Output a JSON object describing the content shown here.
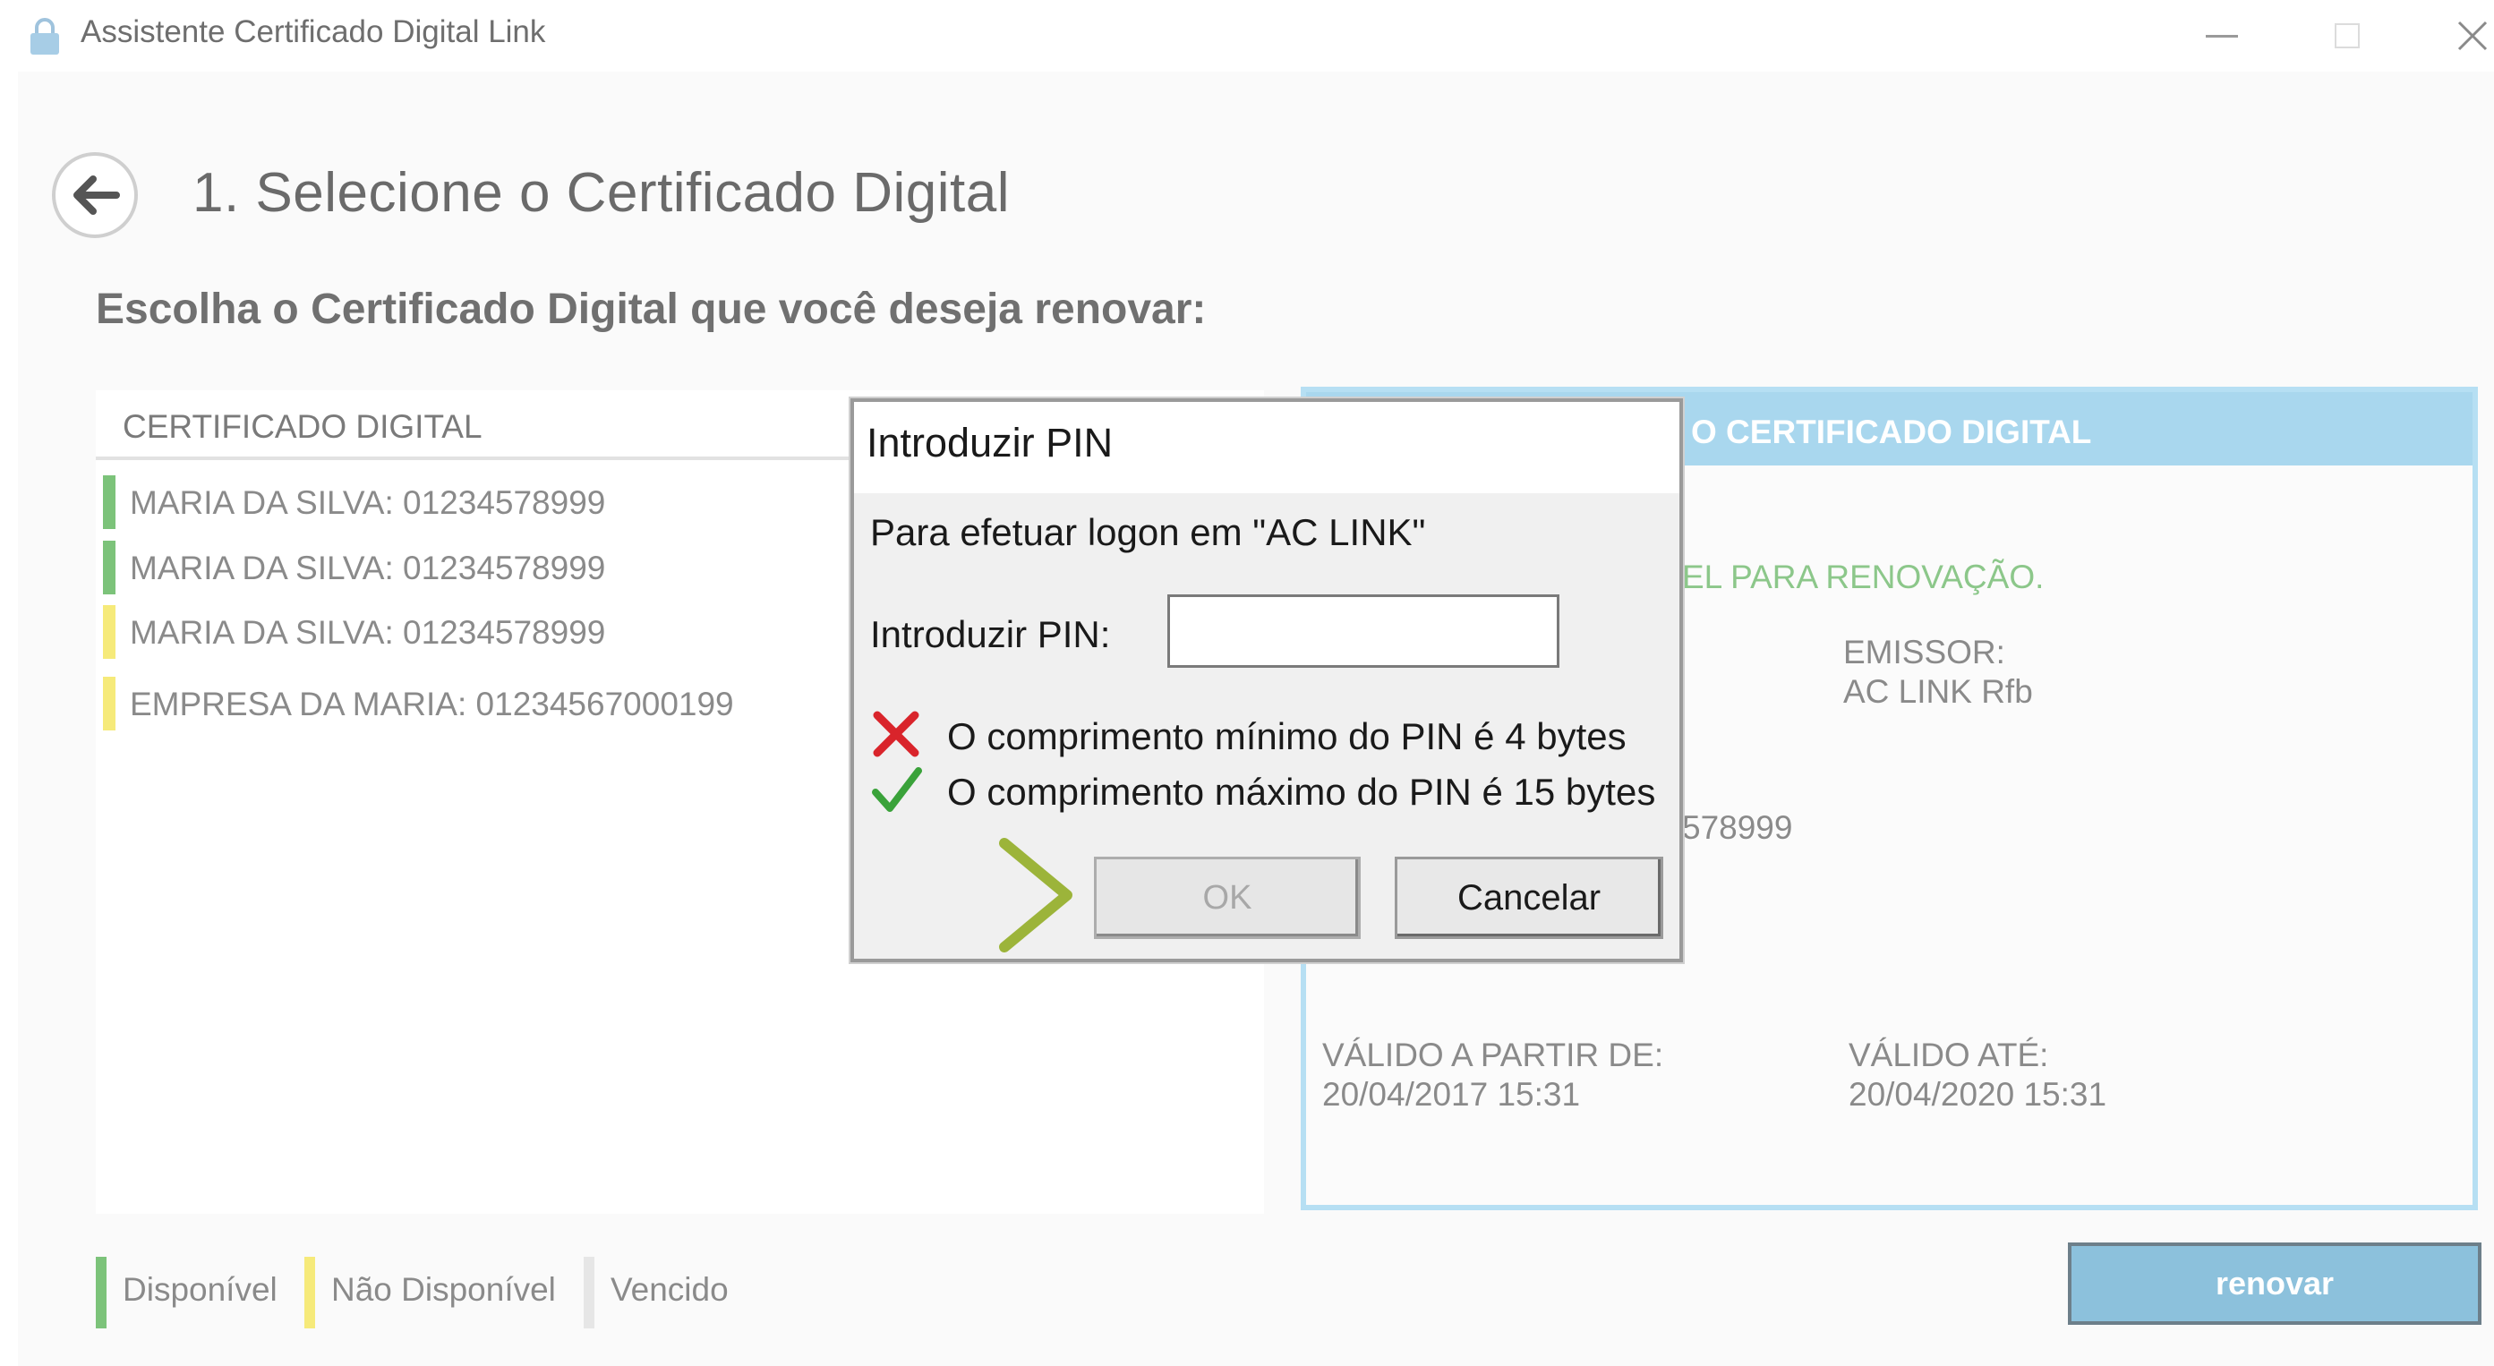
{
  "window": {
    "title": "Assistente Certificado Digital Link"
  },
  "page": {
    "title": "1. Selecione o Certificado Digital",
    "subtitle": "Escolha o Certificado Digital que você deseja renovar:"
  },
  "list": {
    "header": "CERTIFICADO DIGITAL",
    "items": [
      {
        "label": "MARIA DA SILVA: 01234578999",
        "status_color": "#7cc37a"
      },
      {
        "label": "MARIA DA SILVA: 01234578999",
        "status_color": "#7cc37a"
      },
      {
        "label": "MARIA DA SILVA: 01234578999",
        "status_color": "#f6ea7a"
      },
      {
        "label": "EMPRESA DA MARIA: 01234567000199",
        "status_color": "#f6ea7a"
      }
    ]
  },
  "detail": {
    "header": "O CERTIFICADO DIGITAL",
    "status": "EL PARA RENOVAÇÃO.",
    "emissor_label": "EMISSOR:",
    "emissor_value": "AC LINK Rfb",
    "doc_partial": "578999",
    "valid_from_label": "VÁLIDO A PARTIR DE:",
    "valid_from_value": "20/04/2017 15:31",
    "valid_to_label": "VÁLIDO ATÉ:",
    "valid_to_value": "20/04/2020 15:31"
  },
  "legend": {
    "available": "Disponível",
    "unavailable": "Não Disponível",
    "expired": "Vencido",
    "colors": {
      "available": "#7cc37a",
      "unavailable": "#f6ea7a",
      "expired": "#e6e6e6"
    }
  },
  "renew_button": "renovar",
  "pin_dialog": {
    "title": "Introduzir PIN",
    "logon_text": "Para efetuar logon em \"AC LINK\"",
    "pin_label": "Introduzir PIN:",
    "pin_value": "",
    "rule_min": "O comprimento mínimo do PIN é 4 bytes",
    "rule_max": "O comprimento máximo do PIN é 15 bytes",
    "ok": "OK",
    "cancel": "Cancelar"
  },
  "colors": {
    "accent_chevron": "#9cb43a",
    "error": "#d9242b",
    "success": "#3aa23a"
  }
}
